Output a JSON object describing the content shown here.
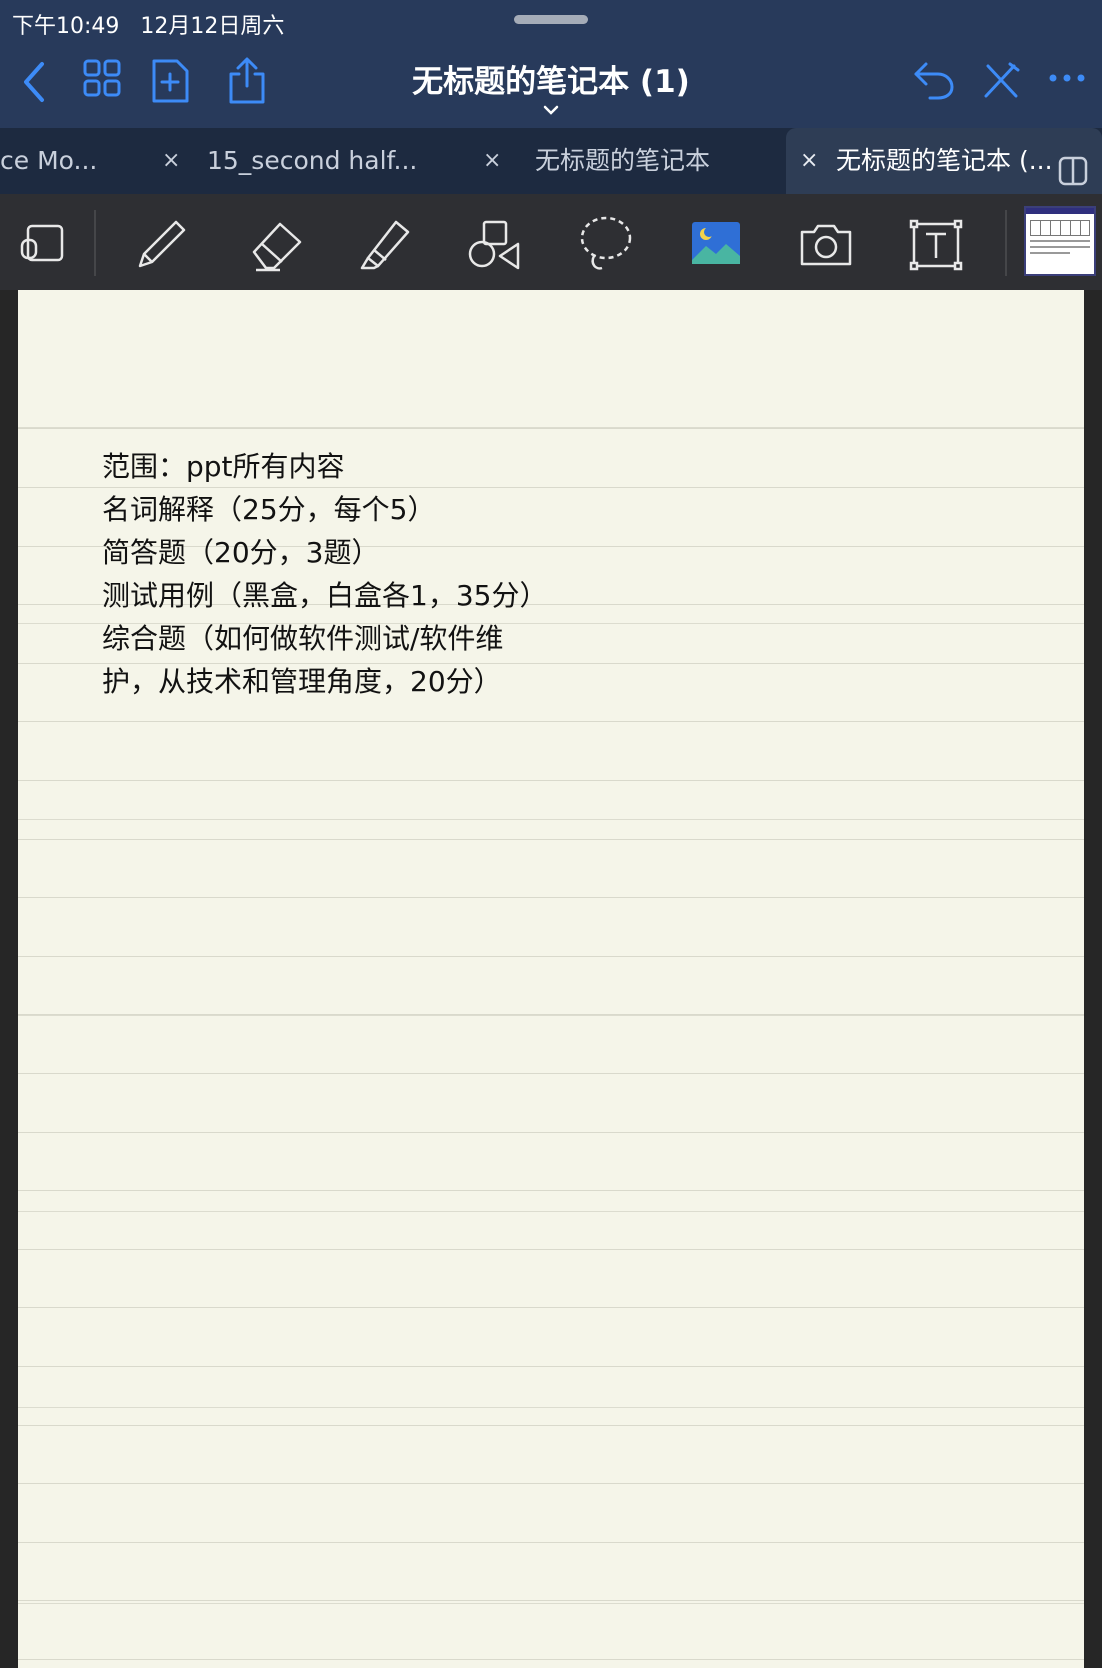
{
  "status": {
    "time": "下午10:49",
    "date": "12月12日周六"
  },
  "header": {
    "title": "无标题的笔记本 (1)"
  },
  "tabs": [
    {
      "label": "ce Mo...",
      "close": "×"
    },
    {
      "label": "15_second half...",
      "close": "×"
    },
    {
      "label": "无标题的笔记本",
      "close": "×"
    },
    {
      "label": "无标题的笔记本 (...",
      "active": true
    }
  ],
  "toolbar": {
    "tools": [
      "lasso-select-icon",
      "pen-icon",
      "eraser-icon",
      "highlighter-icon",
      "shapes-icon",
      "lasso-icon",
      "image-icon",
      "camera-icon",
      "text-icon"
    ]
  },
  "note": {
    "lines": [
      "范围：ppt所有内容",
      "名词解释（25分，每个5）",
      "简答题（20分，3题）",
      "测试用例（黑盒，白盒各1，35分）",
      "综合题（如何做软件测试/软件维",
      "护，从技术和管理角度，20分）"
    ]
  },
  "colors": {
    "accent": "#3b82f6",
    "header_bg": "#283a5b",
    "paper": "#f5f5e9"
  }
}
